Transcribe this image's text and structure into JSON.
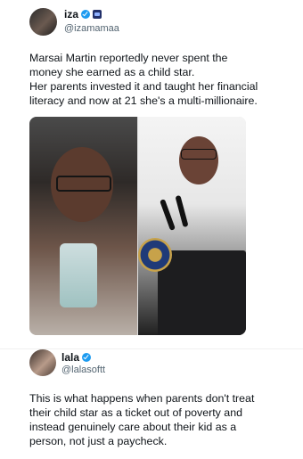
{
  "post1": {
    "display_name": "iza",
    "handle": "@izamamaa",
    "text": "Marsai Martin reportedly never spent the\nmoney she earned as a child star.\nHer parents invested it and taught her financial\nliteracy and now at 21 she's a multi-millionaire.",
    "icons": {
      "avatar": "profile-avatar",
      "verified": "verified-badge-icon",
      "affiliate": "affiliate-badge-icon"
    }
  },
  "post2": {
    "display_name": "lala",
    "handle": "@lalasoftt",
    "text": "This is what happens when parents don't treat\ntheir child star as a ticket out of poverty and\ninstead genuinely care about their kid as a\nperson, not just a paycheck.",
    "icons": {
      "avatar": "profile-avatar",
      "verified": "verified-badge-icon"
    }
  },
  "colors": {
    "verified": "#1d9bf0",
    "handle": "#536471",
    "text": "#0f1419"
  }
}
